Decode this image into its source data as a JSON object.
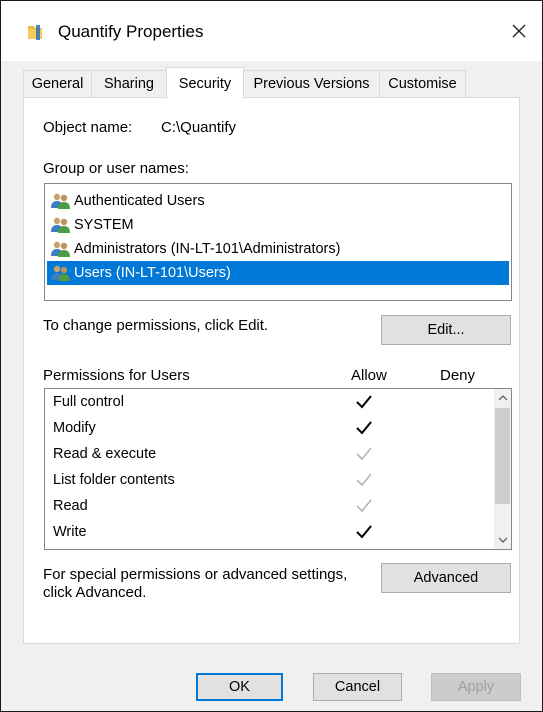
{
  "window": {
    "title": "Quantify Properties",
    "close_glyph": "✕"
  },
  "tabs": [
    {
      "label": "General"
    },
    {
      "label": "Sharing"
    },
    {
      "label": "Security"
    },
    {
      "label": "Previous Versions"
    },
    {
      "label": "Customise"
    }
  ],
  "active_tab": "Security",
  "object": {
    "label": "Object name:",
    "value": "C:\\Quantify"
  },
  "group_label": "Group or user names:",
  "users": [
    {
      "name": "Authenticated Users",
      "selected": false
    },
    {
      "name": "SYSTEM",
      "selected": false
    },
    {
      "name": "Administrators (IN-LT-101\\Administrators)",
      "selected": false
    },
    {
      "name": "Users (IN-LT-101\\Users)",
      "selected": true
    }
  ],
  "change_text": "To change permissions, click Edit.",
  "edit_button": "Edit...",
  "permissions": {
    "header": "Permissions for Users",
    "allow_label": "Allow",
    "deny_label": "Deny",
    "rows": [
      {
        "name": "Full control",
        "allow": "checked"
      },
      {
        "name": "Modify",
        "allow": "checked"
      },
      {
        "name": "Read & execute",
        "allow": "inherited"
      },
      {
        "name": "List folder contents",
        "allow": "inherited"
      },
      {
        "name": "Read",
        "allow": "inherited"
      },
      {
        "name": "Write",
        "allow": "checked"
      }
    ]
  },
  "special_text_line1": "For special permissions or advanced settings,",
  "special_text_line2": "click Advanced.",
  "advanced_button": "Advanced",
  "footer": {
    "ok": "OK",
    "cancel": "Cancel",
    "apply": "Apply"
  },
  "colors": {
    "selection": "#0078d7",
    "check_active": "#000000",
    "check_inherited": "#b4b4b4"
  }
}
